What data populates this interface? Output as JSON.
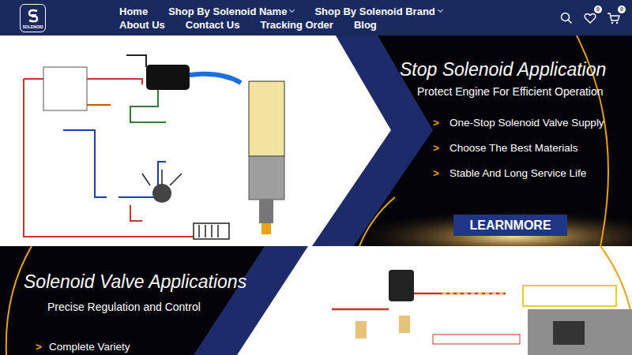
{
  "logo": {
    "text": "SOLENOID"
  },
  "nav": [
    {
      "label": "Home",
      "dropdown": false
    },
    {
      "label": "Shop By Solenoid Name",
      "dropdown": true
    },
    {
      "label": "Shop By Solenoid Brand",
      "dropdown": true
    },
    {
      "label": "About Us",
      "dropdown": false
    },
    {
      "label": "Contact Us",
      "dropdown": false
    },
    {
      "label": "Tracking Order",
      "dropdown": false
    },
    {
      "label": "Blog",
      "dropdown": false
    }
  ],
  "header_icons": {
    "wishlist_count": "0",
    "cart_count": "0"
  },
  "banners": [
    {
      "title": "Stop Solenoid Application",
      "subtitle": "Protect Engine For Efficient Operation",
      "bullets": [
        {
          "marker": ">",
          "text": "One-Stop Solenoid Valve Supply"
        },
        {
          "marker": ">",
          "text": "Choose The Best Materials"
        },
        {
          "marker": ">",
          "text": "Stable And Long Service Life"
        }
      ],
      "button": "LEARNMORE"
    },
    {
      "title": "Solenoid Valve Applications",
      "subtitle": "Precise Regulation and Control",
      "bullets": [
        {
          "marker": ">",
          "text": "Complete Variety"
        }
      ]
    }
  ]
}
